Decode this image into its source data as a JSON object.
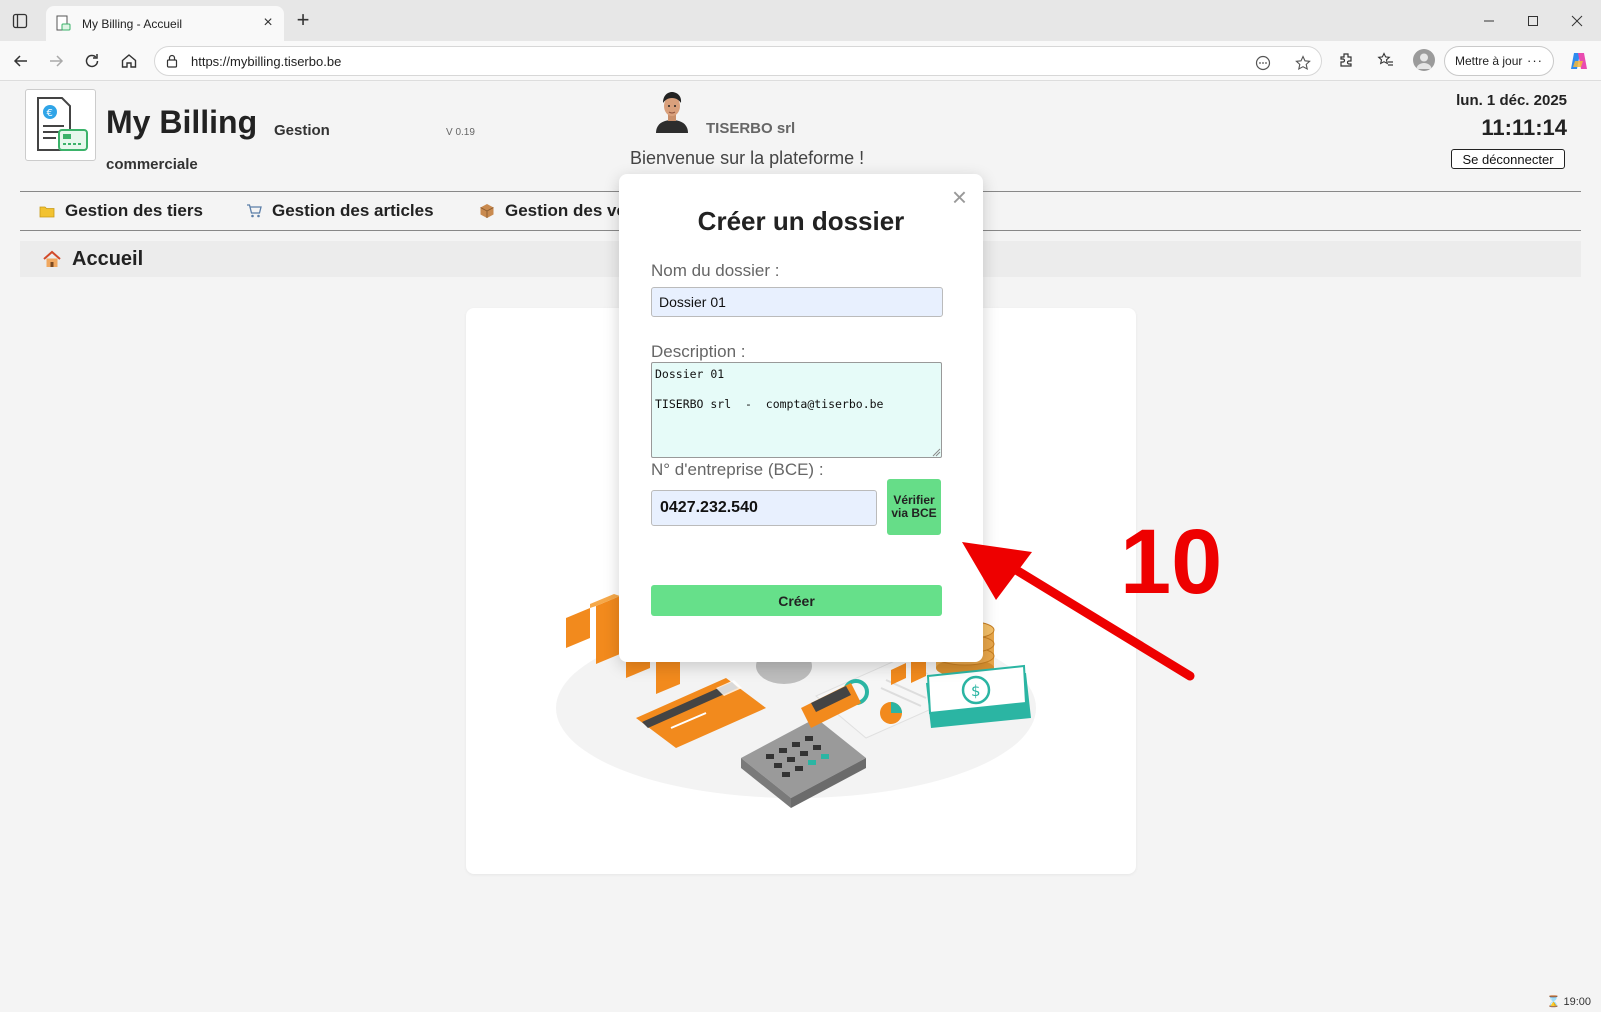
{
  "browser": {
    "tab_title": "My Billing - Accueil",
    "url": "https://mybilling.tiserbo.be",
    "update_label": "Mettre à jour",
    "more_label": "···"
  },
  "header": {
    "app_title": "My Billing",
    "app_subtitle_1": "Gestion",
    "app_subtitle_2": "commerciale",
    "version": "V 0.19",
    "company": "TISERBO srl",
    "welcome": "Bienvenue sur la plateforme !",
    "date": "lun. 1 déc. 2025",
    "time": "11:11:14",
    "logout_label": "Se déconnecter"
  },
  "menu": {
    "items": [
      {
        "label": "Gestion des tiers",
        "icon": "folder-icon"
      },
      {
        "label": "Gestion des articles",
        "icon": "cart-icon"
      },
      {
        "label": "Gestion des ventes",
        "icon": "box-icon"
      }
    ]
  },
  "breadcrumb": {
    "label": "Accueil",
    "icon": "home-icon"
  },
  "modal": {
    "close_symbol": "×",
    "title": "Créer un dossier",
    "name_label": "Nom du dossier :",
    "name_value": "Dossier 01",
    "description_label": "Description :",
    "description_value": "Dossier 01\n\nTISERBO srl  -  compta@tiserbo.be",
    "bce_label": "N° d'entreprise (BCE) :",
    "bce_value": "0427.232.540",
    "verify_label": "Vérifier via BCE",
    "create_label": "Créer"
  },
  "annotation": {
    "number": "10",
    "color": "#ee0000"
  },
  "statusbar": {
    "text": "⌛ 19:00"
  },
  "colors": {
    "accent_green": "#66e08a",
    "field_blue": "#e8f0fe",
    "textarea_bg": "#e6fbf8"
  }
}
